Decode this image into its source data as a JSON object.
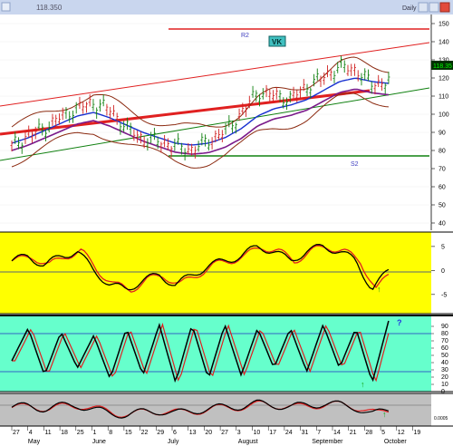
{
  "window": {
    "title_value": "118.350",
    "period_label": "Daily",
    "buttons": [
      "minimize",
      "maximize",
      "close"
    ]
  },
  "price_panel": {
    "last_price_tag": "118.35",
    "labels": {
      "r2": "R2",
      "s2": "S2",
      "vk": "VK"
    },
    "y_ticks": [
      150,
      140,
      130,
      120,
      110,
      100,
      90,
      80,
      70,
      60,
      50,
      40
    ],
    "y_min": 36,
    "y_max": 155,
    "r2_level": 149.5,
    "s2_level": 64.5
  },
  "momentum_panel": {
    "y_ticks": [
      "5",
      "0",
      "-5"
    ],
    "bg_color": "#ffff00",
    "signal_arrow": "up-arrow"
  },
  "stochastic_panel": {
    "y_ticks": [
      "90",
      "80",
      "70",
      "60",
      "50",
      "40",
      "30",
      "20",
      "10",
      "0"
    ],
    "bg_color": "#66ffcc",
    "levels": [
      80,
      20
    ],
    "question_mark": "?",
    "signal_arrow": "up-arrow"
  },
  "bottom_panel": {
    "scale_label": "0.0005",
    "bg_color": "#c0c0c0",
    "signal_arrow": "up-arrow"
  },
  "x_axis": {
    "day_ticks": [
      "27",
      "4",
      "11",
      "18",
      "25",
      "1",
      "8",
      "15",
      "22",
      "29",
      "6",
      "13",
      "20",
      "27",
      "3",
      "10",
      "17",
      "24",
      "31",
      "7",
      "14",
      "21",
      "28",
      "5",
      "12",
      "19"
    ],
    "months": [
      "May",
      "June",
      "July",
      "August",
      "September",
      "October"
    ]
  },
  "chart_data": {
    "type": "line",
    "title": "",
    "x": [
      "Apr 27",
      "May 4",
      "May 11",
      "May 18",
      "May 25",
      "Jun 1",
      "Jun 8",
      "Jun 15",
      "Jun 22",
      "Jun 29",
      "Jul 6",
      "Jul 13",
      "Jul 20",
      "Jul 27",
      "Aug 3",
      "Aug 10",
      "Aug 17",
      "Aug 24",
      "Aug 31",
      "Sep 7",
      "Sep 14",
      "Sep 21",
      "Sep 28",
      "Oct 5"
    ],
    "series": [
      {
        "values": [
          82,
          88,
          92,
          98,
          103,
          106,
          102,
          92,
          86,
          85,
          82,
          80,
          85,
          90,
          100,
          112,
          110,
          108,
          115,
          120,
          126,
          124,
          116,
          118
        ]
      },
      {
        "values": [
          84,
          87,
          91,
          95,
          99,
          101,
          98,
          94,
          90,
          87,
          84,
          83,
          84,
          87,
          92,
          99,
          103,
          105,
          108,
          113,
          118,
          120,
          118,
          117
        ]
      },
      {
        "values": [
          2,
          3,
          1,
          3,
          4,
          0,
          -3,
          -4,
          -2,
          -1,
          -3,
          -1,
          1,
          2,
          3,
          5,
          4,
          2,
          4,
          5,
          4,
          2,
          -4,
          0
        ]
      },
      {
        "values": [
          40,
          85,
          20,
          80,
          30,
          75,
          15,
          85,
          20,
          90,
          10,
          90,
          15,
          90,
          20,
          85,
          30,
          85,
          25,
          90,
          30,
          85,
          10,
          95
        ]
      }
    ],
    "ylim": [
      36,
      155
    ]
  }
}
